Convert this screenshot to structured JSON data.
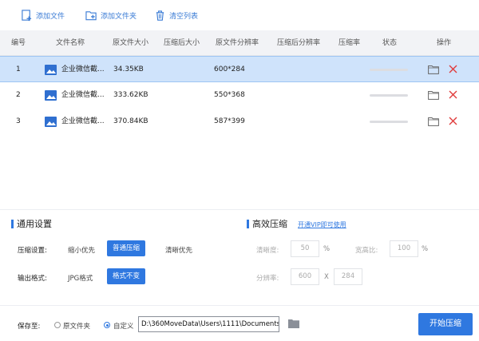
{
  "toolbar": {
    "add_file": "添加文件",
    "add_folder": "添加文件夹",
    "clear_list": "清空列表"
  },
  "table": {
    "headers": [
      "编号",
      "文件名称",
      "原文件大小",
      "压缩后大小",
      "原文件分辨率",
      "压缩后分辨率",
      "压缩率",
      "状态",
      "操作"
    ],
    "rows": [
      {
        "no": "1",
        "name": "企业微信截...",
        "size": "34.35KB",
        "res": "600*284",
        "selected": true
      },
      {
        "no": "2",
        "name": "企业微信截...",
        "size": "333.62KB",
        "res": "550*368",
        "selected": false
      },
      {
        "no": "3",
        "name": "企业微信截...",
        "size": "370.84KB",
        "res": "587*399",
        "selected": false
      }
    ]
  },
  "general": {
    "title": "通用设置",
    "compress_label": "压缩设置:",
    "compress_options": [
      "缩小优先",
      "普通压缩",
      "清晰优先"
    ],
    "compress_selected": "普通压缩",
    "format_label": "输出格式:",
    "format_options": [
      "JPG格式",
      "格式不变"
    ],
    "format_selected": "格式不变"
  },
  "advanced": {
    "title": "高效压缩",
    "vip_link": "开通VIP即可使用",
    "clarity_label": "清晰度:",
    "clarity_value": "50",
    "clarity_unit": "%",
    "ratio_label": "宽高比:",
    "ratio_value": "100",
    "ratio_unit": "%",
    "resolution_label": "分辨率:",
    "res_w": "600",
    "res_x": "X",
    "res_h": "284"
  },
  "footer": {
    "save_label": "保存至:",
    "opt_original": "原文件夹",
    "opt_custom": "自定义",
    "custom_selected": true,
    "path": "D:\\360MoveData\\Users\\1111\\Documents",
    "start_button": "开始压缩"
  },
  "colors": {
    "accent": "#2f78e0",
    "selected_row": "#cfe3fb",
    "delete": "#e03b3b"
  }
}
